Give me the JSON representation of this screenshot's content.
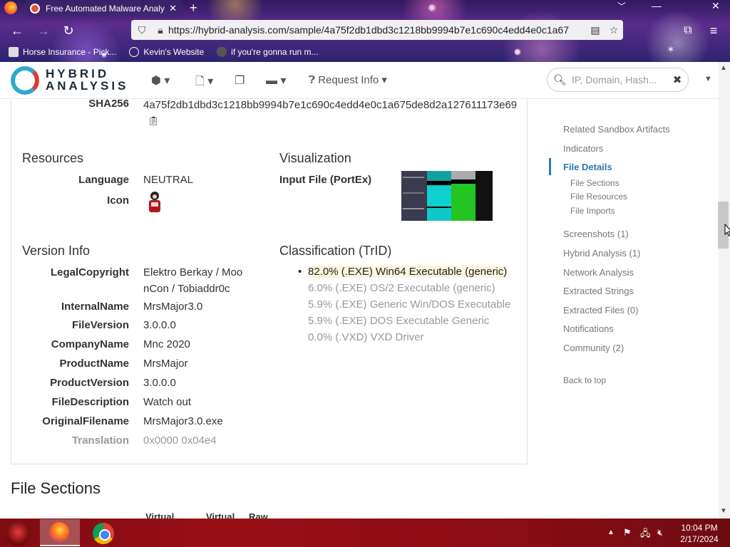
{
  "browser": {
    "tab_title": "Free Automated Malware Analy",
    "new_tab": "+",
    "url": "https://hybrid-analysis.com/sample/4a75f2db1dbd3c1218bb9994b7e1c690c4edd4e0c1a67",
    "bookmarks": [
      {
        "label": "Horse Insurance - Pick...",
        "icon": "horse-icon"
      },
      {
        "label": "Kevin's Website",
        "icon": "globe-icon"
      },
      {
        "label": "if you're gonna run m...",
        "icon": "mask-icon"
      }
    ]
  },
  "site": {
    "logo_line1": "HYBRID",
    "logo_line2": "ANALYSIS",
    "request_info": "Request Info",
    "search_placeholder": "IP, Domain, Hash..."
  },
  "details": {
    "sha256_label": "SHA256",
    "sha256_value": "4a75f2db1dbd3c1218bb9994b7e1c690c4edd4e0c1a675de8d2a127611173e69",
    "resources_title": "Resources",
    "language_label": "Language",
    "language_value": "NEUTRAL",
    "icon_label": "Icon",
    "visualization_title": "Visualization",
    "input_file_label": "Input File (PortEx)",
    "version_info_title": "Version Info",
    "version_info": [
      {
        "label": "LegalCopyright",
        "value": "Elektro Berkay / Moo nCon / Tobiaddr0c"
      },
      {
        "label": "InternalName",
        "value": "MrsMajor3.0"
      },
      {
        "label": "FileVersion",
        "value": "3.0.0.0"
      },
      {
        "label": "CompanyName",
        "value": "Mnc 2020"
      },
      {
        "label": "ProductName",
        "value": "MrsMajor"
      },
      {
        "label": "ProductVersion",
        "value": "3.0.0.0"
      },
      {
        "label": "FileDescription",
        "value": "Watch out"
      },
      {
        "label": "OriginalFilename",
        "value": "MrsMajor3.0.exe"
      },
      {
        "label": "Translation",
        "value": "0x0000 0x04e4"
      }
    ],
    "classification_title": "Classification (TrID)",
    "trid": [
      "82.0% (.EXE) Win64 Executable (generic)",
      "6.0% (.EXE) OS/2 Executable (generic)",
      "5.9% (.EXE) Generic Win/DOS Executable",
      "5.9% (.EXE) DOS Executable Generic",
      "0.0% (.VXD) VXD Driver"
    ],
    "file_sections_title": "File Sections",
    "file_sections_headers": [
      "Virtual",
      "Virtual",
      "Raw"
    ]
  },
  "rightnav": {
    "items": [
      "Related Sandbox Artifacts",
      "Indicators",
      "File Details",
      "File Sections",
      "File Resources",
      "File Imports",
      "Screenshots (1)",
      "Hybrid Analysis (1)",
      "Network Analysis",
      "Extracted Strings",
      "Extracted Files (0)",
      "Notifications",
      "Community (2)",
      "Back to top"
    ]
  },
  "taskbar": {
    "time": "10:04 PM",
    "date": "2/17/2024"
  },
  "colors": {
    "accent": "#2a7ab0",
    "highlight": "#fdf5dc",
    "taskbar": "#8a0d14"
  }
}
